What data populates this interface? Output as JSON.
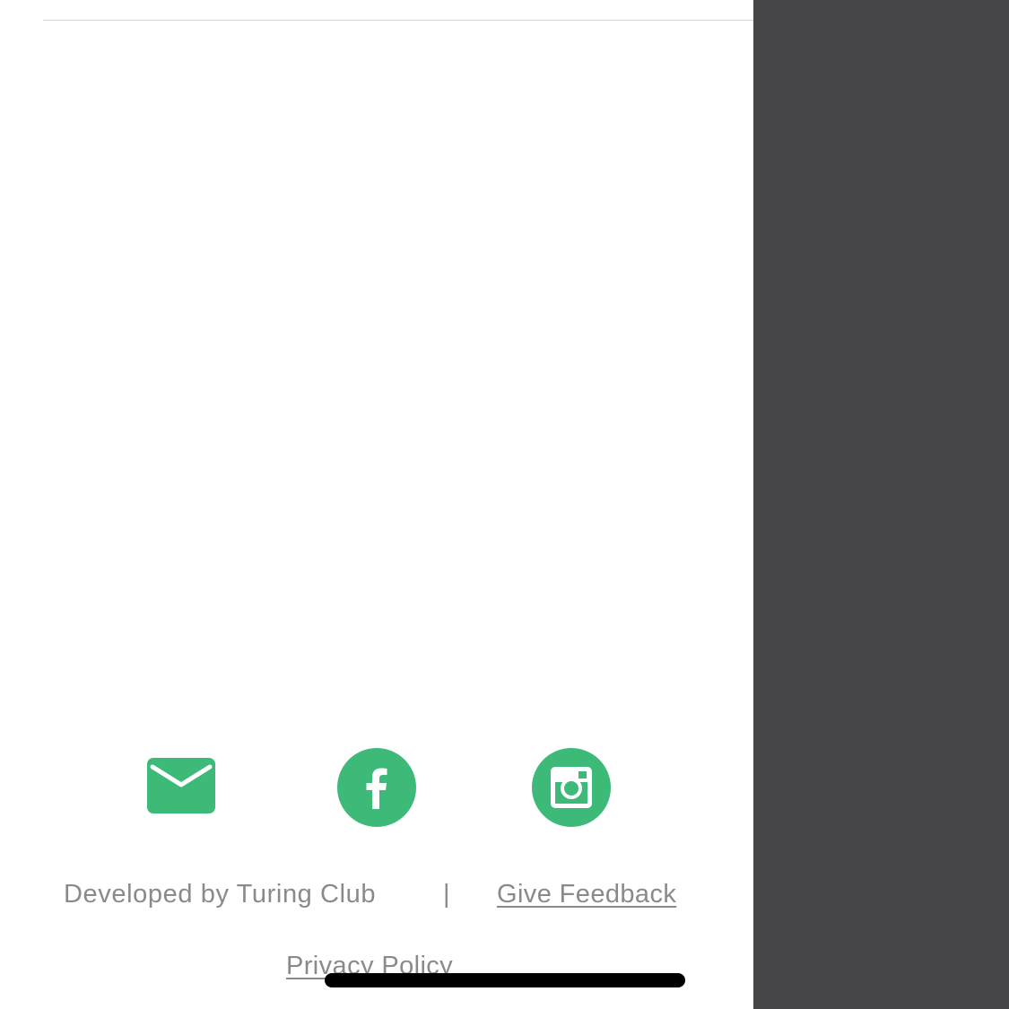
{
  "colors": {
    "accent": "#3dba78",
    "footer_text": "#8a8a8a",
    "overlay": "#464648",
    "divider": "#d6d6d6"
  },
  "social": {
    "email": {
      "icon": "email-icon"
    },
    "facebook": {
      "icon": "facebook-icon"
    },
    "instagram": {
      "icon": "instagram-icon"
    }
  },
  "footer": {
    "developed_by": "Developed by Turing Club",
    "separator": "|",
    "feedback_label": "Give Feedback",
    "privacy_label": "Privacy Policy"
  }
}
